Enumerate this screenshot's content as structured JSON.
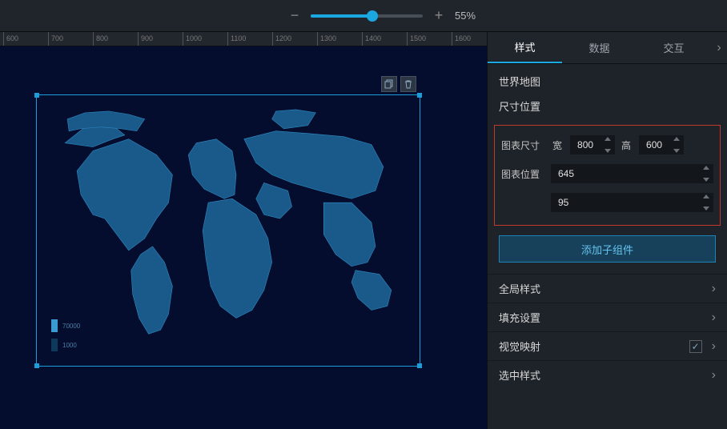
{
  "zoom": {
    "percent_label": "55%",
    "fill_pct": 55
  },
  "ruler_ticks": [
    "600",
    "700",
    "800",
    "900",
    "1000",
    "1100",
    "1200",
    "1300",
    "1400",
    "1500",
    "1600"
  ],
  "tabs": {
    "style": "样式",
    "data": "数据",
    "interaction": "交互"
  },
  "component_name": "世界地图",
  "size_pos_title": "尺寸位置",
  "labels": {
    "chart_size": "图表尺寸",
    "width": "宽",
    "height": "高",
    "chart_pos": "图表位置"
  },
  "values": {
    "width": "800",
    "height": "600",
    "pos_x": "645",
    "pos_y": "95"
  },
  "add_sub_btn": "添加子组件",
  "exp_sections": {
    "global_style": "全局样式",
    "fill_settings": "填充设置",
    "visual_map": "视觉映射",
    "select_style": "选中样式"
  },
  "legend": {
    "max": "70000",
    "min": "1000"
  }
}
